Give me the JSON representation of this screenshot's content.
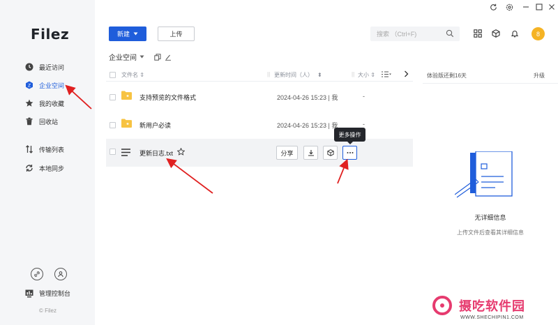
{
  "app": {
    "logo": "Filez",
    "copyright": "© Filez"
  },
  "sidebar": {
    "items": [
      {
        "label": "最近访问",
        "icon": "clock-icon"
      },
      {
        "label": "企业空间",
        "icon": "enterprise-space-icon",
        "active": true
      },
      {
        "label": "我的收藏",
        "icon": "star-icon"
      },
      {
        "label": "回收站",
        "icon": "trash-icon"
      },
      {
        "label": "传输列表",
        "icon": "transfer-icon"
      },
      {
        "label": "本地同步",
        "icon": "sync-icon"
      }
    ],
    "console_label": "管理控制台"
  },
  "toolbar": {
    "new_label": "新建",
    "upload_label": "上传",
    "search_placeholder": "搜索 （Ctrl+F)"
  },
  "breadcrumb": {
    "label": "企业空间"
  },
  "table": {
    "headers": {
      "name": "文件名",
      "modified": "更新时间（人）",
      "size": "大小"
    },
    "rows": [
      {
        "name": "支持预览的文件格式",
        "type": "folder",
        "modified": "2024-04-26 15:23 | 我",
        "size": "-"
      },
      {
        "name": "新用户必读",
        "type": "folder",
        "modified": "2024-04-26 15:23 | 我",
        "size": "-"
      },
      {
        "name": "更新日志.txt",
        "type": "file",
        "share_label": "分享"
      }
    ],
    "tooltip": "更多操作"
  },
  "right_panel": {
    "title": "体验版还剩16天",
    "upgrade": "升级",
    "empty_title": "无详细信息",
    "empty_sub": "上传文件后查看其详细信息"
  },
  "watermark": {
    "text": "摄吃软件园",
    "url": "WWW.SHECHIPIN1.COM"
  },
  "colors": {
    "accent": "#1f5ddb",
    "folder": "#f7c342",
    "avatar": "#f5b324",
    "annotation": "#e02020",
    "watermark": "#e63b6f"
  },
  "user": {
    "avatar_text": "8"
  }
}
